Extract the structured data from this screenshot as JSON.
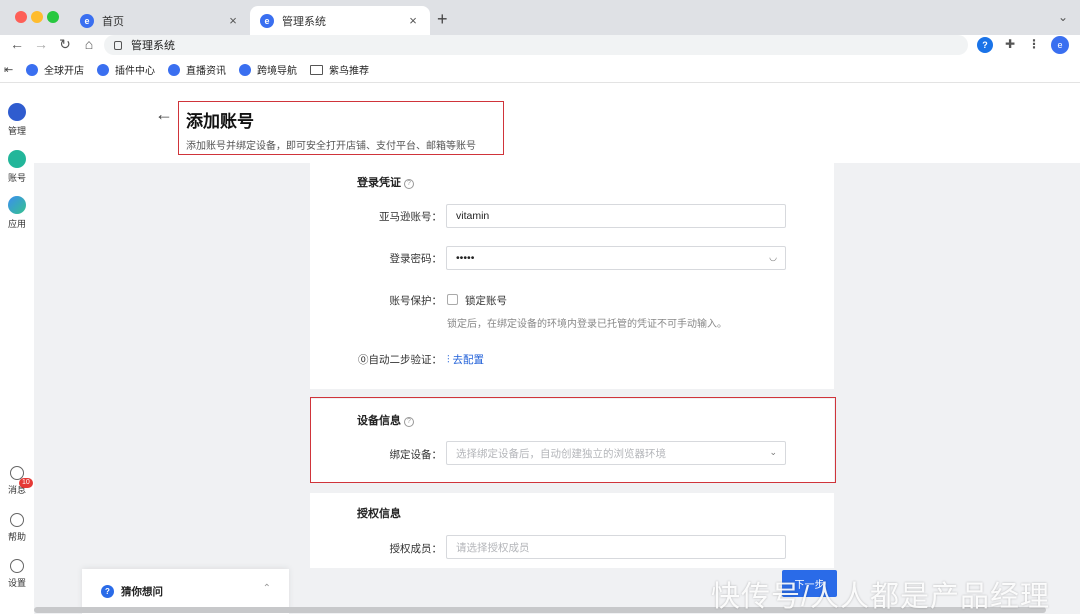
{
  "browser": {
    "tabs": [
      {
        "label": "首页"
      },
      {
        "label": "管理系统"
      }
    ],
    "address": "管理系统",
    "bookmarks": [
      "全球开店",
      "插件中心",
      "直播资讯",
      "跨境导航",
      "紫鸟推荐"
    ]
  },
  "sidebar": {
    "items": [
      {
        "label": "管理",
        "icon": "grid-icon"
      },
      {
        "label": "账号",
        "icon": "account-icon"
      },
      {
        "label": "应用",
        "icon": "apps-icon"
      }
    ],
    "bottom": [
      {
        "label": "消息",
        "icon": "bell-icon",
        "badge": "10"
      },
      {
        "label": "帮助",
        "icon": "help-icon"
      },
      {
        "label": "设置",
        "icon": "gear-icon"
      }
    ]
  },
  "header": {
    "title": "添加账号",
    "subtitle": "添加账号并绑定设备，即可安全打开店铺、支付平台、邮箱等账号"
  },
  "login_section": {
    "title": "登录凭证",
    "amazon_label": "亚马逊账号：",
    "amazon_value": "vitamin",
    "password_label": "登录密码：",
    "password_value": "•••••",
    "protect_label": "账号保护：",
    "lock_label": "锁定账号",
    "lock_hint": "锁定后，在绑定设备的环境内登录已托管的凭证不可手动输入。",
    "twofa_label": "⓪自动二步验证：",
    "twofa_link": "去配置"
  },
  "device_section": {
    "title": "设备信息",
    "bind_label": "绑定设备：",
    "bind_placeholder": "选择绑定设备后，自动创建独立的浏览器环境"
  },
  "auth_section": {
    "title": "授权信息",
    "member_label": "授权成员：",
    "member_placeholder": "请选择授权成员"
  },
  "footer": {
    "next_label": "下一步",
    "chat_label": "猜你想问",
    "watermark": "快传号/人人都是产品经理"
  },
  "colors": {
    "accent": "#2a6be8",
    "highlight_border": "#d0343a"
  }
}
